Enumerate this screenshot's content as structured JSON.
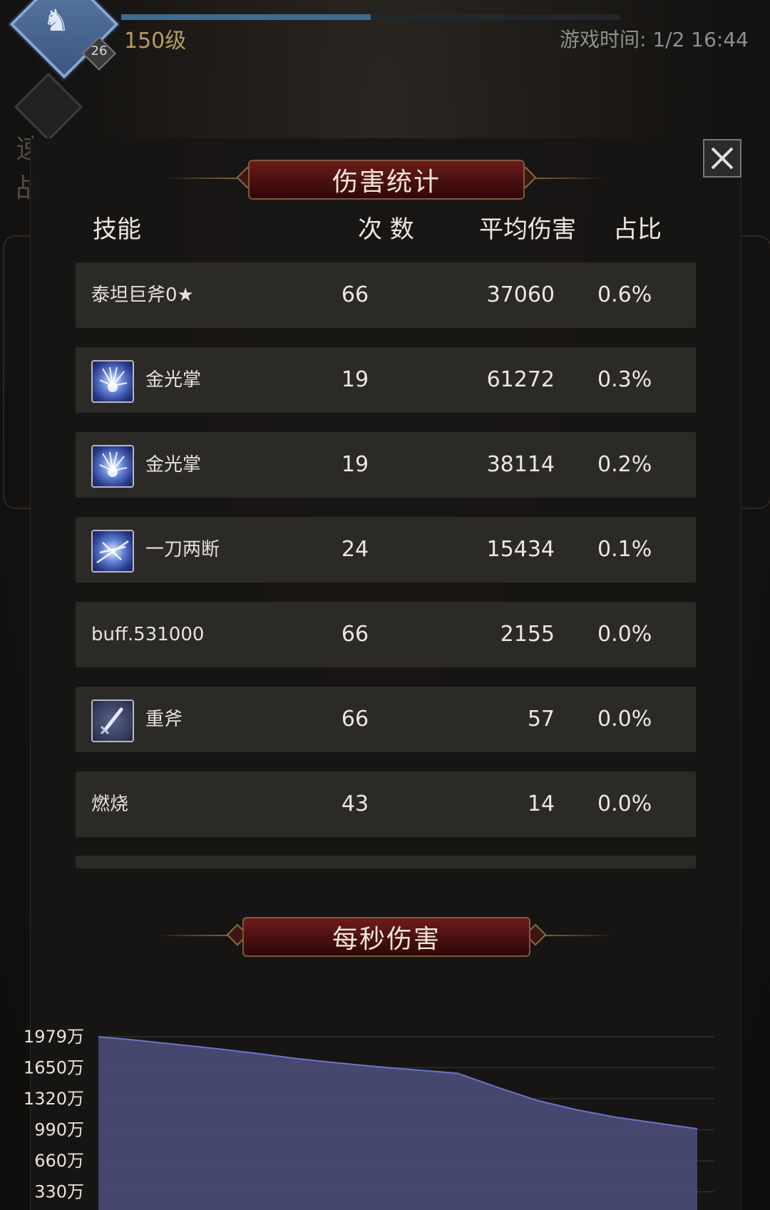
{
  "hud": {
    "level": "150级",
    "badge": "26",
    "game_time": "游戏时间: 1/2 16:44",
    "xp_progress": 0.5,
    "quick_battle_label": "速 战"
  },
  "damage_stats": {
    "title": "伤害统计",
    "headers": {
      "skill": "技能",
      "count": "次 数",
      "avg": "平均伤害",
      "ratio": "占比"
    },
    "rows": [
      {
        "name": "泰坦巨斧0★",
        "icon": null,
        "count": "66",
        "avg": "37060",
        "ratio": "0.6%"
      },
      {
        "name": "金光掌",
        "icon": "golden-palm-skill-icon",
        "count": "19",
        "avg": "61272",
        "ratio": "0.3%"
      },
      {
        "name": "金光掌",
        "icon": "golden-palm-skill-icon",
        "count": "19",
        "avg": "38114",
        "ratio": "0.2%"
      },
      {
        "name": "一刀两断",
        "icon": "slash-skill-icon",
        "count": "24",
        "avg": "15434",
        "ratio": "0.1%"
      },
      {
        "name": "buff.531000",
        "icon": null,
        "count": "66",
        "avg": "2155",
        "ratio": "0.0%"
      },
      {
        "name": "重斧",
        "icon": "sword-skill-icon",
        "count": "66",
        "avg": "57",
        "ratio": "0.0%"
      },
      {
        "name": "燃烧",
        "icon": null,
        "count": "43",
        "avg": "14",
        "ratio": "0.0%"
      }
    ]
  },
  "dps": {
    "title": "每秒伤害"
  },
  "chart_data": {
    "type": "area",
    "title": "每秒伤害",
    "y_unit": "万",
    "y_ticks": [
      "1979万",
      "1650万",
      "1320万",
      "990万",
      "660万",
      "330万"
    ],
    "y_tick_values": [
      1979,
      1650,
      1320,
      990,
      660,
      330
    ],
    "ylim_visible": [
      330,
      1979
    ],
    "series": [
      {
        "values": [
          1979,
          1940,
          1895,
          1850,
          1800,
          1745,
          1700,
          1660,
          1625,
          1590,
          1440,
          1300,
          1200,
          1120,
          1060,
          1000
        ]
      }
    ],
    "grid": true,
    "colors": {
      "fill": "#4b4d78",
      "line": "#6a74c8"
    }
  }
}
